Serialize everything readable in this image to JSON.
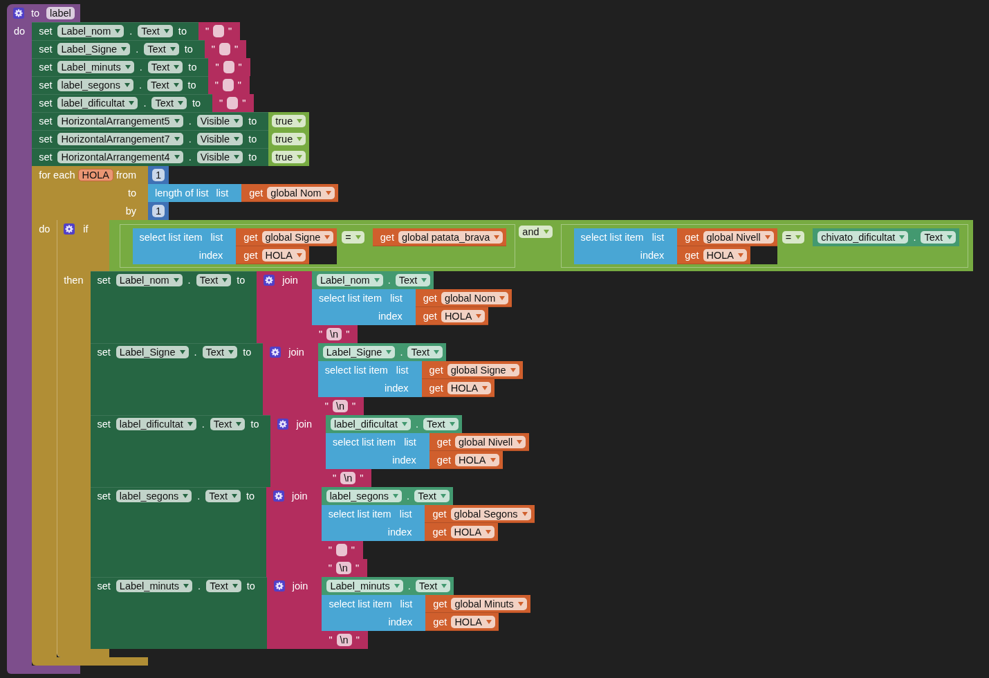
{
  "procedure": {
    "kind": "procedure",
    "keyword": "to",
    "name": "label",
    "do": "do",
    "statements": [
      {
        "kind": "set",
        "set": "set",
        "component": "Label_nom",
        "dot": ".",
        "property": "Text",
        "to": "to",
        "value": {
          "kind": "text",
          "open": "\"",
          "close": "\""
        }
      },
      {
        "kind": "set",
        "set": "set",
        "component": "Label_Signe",
        "dot": ".",
        "property": "Text",
        "to": "to",
        "value": {
          "kind": "text",
          "open": "\"",
          "close": "\""
        }
      },
      {
        "kind": "set",
        "set": "set",
        "component": "Label_minuts",
        "dot": ".",
        "property": "Text",
        "to": "to",
        "value": {
          "kind": "text",
          "open": "\"",
          "close": "\""
        }
      },
      {
        "kind": "set",
        "set": "set",
        "component": "label_segons",
        "dot": ".",
        "property": "Text",
        "to": "to",
        "value": {
          "kind": "text",
          "open": "\"",
          "close": "\""
        }
      },
      {
        "kind": "set",
        "set": "set",
        "component": "label_dificultat",
        "dot": ".",
        "property": "Text",
        "to": "to",
        "value": {
          "kind": "text",
          "open": "\"",
          "close": "\""
        }
      },
      {
        "kind": "set",
        "set": "set",
        "component": "HorizontalArrangement5",
        "dot": ".",
        "property": "Visible",
        "to": "to",
        "value": {
          "kind": "boolean",
          "value": "true"
        }
      },
      {
        "kind": "set",
        "set": "set",
        "component": "HorizontalArrangement7",
        "dot": ".",
        "property": "Visible",
        "to": "to",
        "value": {
          "kind": "boolean",
          "value": "true"
        }
      },
      {
        "kind": "set",
        "set": "set",
        "component": "HorizontalArrangement4",
        "dot": ".",
        "property": "Visible",
        "to": "to",
        "value": {
          "kind": "boolean",
          "value": "true"
        }
      },
      {
        "kind": "for_each",
        "label": "for each",
        "variable": "HOLA",
        "from": "from",
        "to": "to",
        "by": "by",
        "do": "do",
        "from_value": {
          "kind": "number",
          "value": "1"
        },
        "to_value": {
          "kind": "length_of_list",
          "label": "length of list",
          "list": "list",
          "value": {
            "kind": "get",
            "get": "get",
            "variable": "global Nom"
          }
        },
        "by_value": {
          "kind": "number",
          "value": "1"
        },
        "statements": [
          {
            "kind": "if",
            "if": "if",
            "then": "then",
            "condition": {
              "kind": "logic",
              "operator": "and",
              "left": {
                "kind": "compare",
                "operator": "=",
                "left": {
                  "kind": "select_list_item",
                  "label": "select list item",
                  "list": "list",
                  "index": "index",
                  "list_value": {
                    "kind": "get",
                    "get": "get",
                    "variable": "global Signe"
                  },
                  "index_value": {
                    "kind": "get",
                    "get": "get",
                    "variable": "HOLA"
                  }
                },
                "right": {
                  "kind": "get",
                  "get": "get",
                  "variable": "global patata_brava"
                }
              },
              "right": {
                "kind": "compare",
                "operator": "=",
                "left": {
                  "kind": "select_list_item",
                  "label": "select list item",
                  "list": "list",
                  "index": "index",
                  "list_value": {
                    "kind": "get",
                    "get": "get",
                    "variable": "global Nivell"
                  },
                  "index_value": {
                    "kind": "get",
                    "get": "get",
                    "variable": "HOLA"
                  }
                },
                "right": {
                  "kind": "component_get",
                  "component": "chivato_dificultat",
                  "dot": ".",
                  "property": "Text"
                }
              }
            },
            "statements": [
              {
                "kind": "set",
                "set": "set",
                "component": "Label_nom",
                "dot": ".",
                "property": "Text",
                "to": "to",
                "value": {
                  "kind": "join",
                  "label": "join",
                  "items": [
                    {
                      "kind": "component_get",
                      "component": "Label_nom",
                      "dot": ".",
                      "property": "Text"
                    },
                    {
                      "kind": "select_list_item",
                      "label": "select list item",
                      "list": "list",
                      "index": "index",
                      "list_value": {
                        "kind": "get",
                        "get": "get",
                        "variable": "global Nom"
                      },
                      "index_value": {
                        "kind": "get",
                        "get": "get",
                        "variable": "HOLA"
                      }
                    },
                    {
                      "kind": "text",
                      "open": "\"",
                      "value": "\\n",
                      "close": "\""
                    }
                  ]
                }
              },
              {
                "kind": "set",
                "set": "set",
                "component": "Label_Signe",
                "dot": ".",
                "property": "Text",
                "to": "to",
                "value": {
                  "kind": "join",
                  "label": "join",
                  "items": [
                    {
                      "kind": "component_get",
                      "component": "Label_Signe",
                      "dot": ".",
                      "property": "Text"
                    },
                    {
                      "kind": "select_list_item",
                      "label": "select list item",
                      "list": "list",
                      "index": "index",
                      "list_value": {
                        "kind": "get",
                        "get": "get",
                        "variable": "global Signe"
                      },
                      "index_value": {
                        "kind": "get",
                        "get": "get",
                        "variable": "HOLA"
                      }
                    },
                    {
                      "kind": "text",
                      "open": "\"",
                      "value": "\\n",
                      "close": "\""
                    }
                  ]
                }
              },
              {
                "kind": "set",
                "set": "set",
                "component": "label_dificultat",
                "dot": ".",
                "property": "Text",
                "to": "to",
                "value": {
                  "kind": "join",
                  "label": "join",
                  "items": [
                    {
                      "kind": "component_get",
                      "component": "label_dificultat",
                      "dot": ".",
                      "property": "Text"
                    },
                    {
                      "kind": "select_list_item",
                      "label": "select list item",
                      "list": "list",
                      "index": "index",
                      "list_value": {
                        "kind": "get",
                        "get": "get",
                        "variable": "global Nivell"
                      },
                      "index_value": {
                        "kind": "get",
                        "get": "get",
                        "variable": "HOLA"
                      }
                    },
                    {
                      "kind": "text",
                      "open": "\"",
                      "value": "\\n",
                      "close": "\""
                    }
                  ]
                }
              },
              {
                "kind": "set",
                "set": "set",
                "component": "label_segons",
                "dot": ".",
                "property": "Text",
                "to": "to",
                "value": {
                  "kind": "join",
                  "label": "join",
                  "items": [
                    {
                      "kind": "component_get",
                      "component": "label_segons",
                      "dot": ".",
                      "property": "Text"
                    },
                    {
                      "kind": "select_list_item",
                      "label": "select list item",
                      "list": "list",
                      "index": "index",
                      "list_value": {
                        "kind": "get",
                        "get": "get",
                        "variable": "global Segons"
                      },
                      "index_value": {
                        "kind": "get",
                        "get": "get",
                        "variable": "HOLA"
                      }
                    },
                    {
                      "kind": "text",
                      "open": "\"",
                      "close": "\""
                    },
                    {
                      "kind": "text",
                      "open": "\"",
                      "value": "\\n",
                      "close": "\""
                    }
                  ]
                }
              },
              {
                "kind": "set",
                "set": "set",
                "component": "Label_minuts",
                "dot": ".",
                "property": "Text",
                "to": "to",
                "value": {
                  "kind": "join",
                  "label": "join",
                  "items": [
                    {
                      "kind": "component_get",
                      "component": "Label_minuts",
                      "dot": ".",
                      "property": "Text"
                    },
                    {
                      "kind": "select_list_item",
                      "label": "select list item",
                      "list": "list",
                      "index": "index",
                      "list_value": {
                        "kind": "get",
                        "get": "get",
                        "variable": "global Minuts"
                      },
                      "index_value": {
                        "kind": "get",
                        "get": "get",
                        "variable": "HOLA"
                      }
                    },
                    {
                      "kind": "text",
                      "open": "\"",
                      "value": "\\n",
                      "close": "\""
                    }
                  ]
                }
              }
            ]
          }
        ]
      }
    ]
  }
}
